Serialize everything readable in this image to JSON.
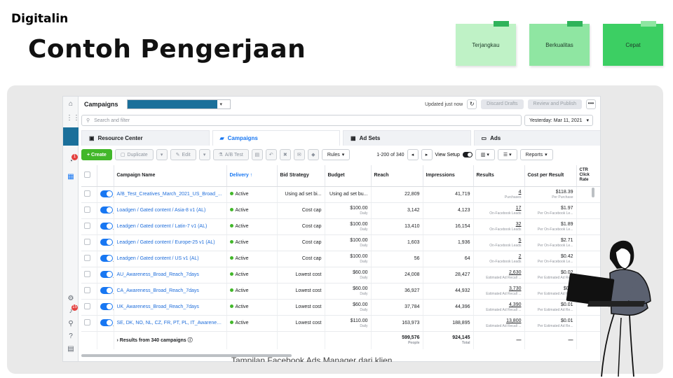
{
  "slide": {
    "brand": "Digitalin",
    "headline": "Contoh Pengerjaan",
    "notes": [
      {
        "label": "Terjangkau",
        "color": "#bff2c6",
        "tape": "#2fb35a"
      },
      {
        "label": "Berkualitas",
        "color": "#8fe6a2",
        "tape": "#2fb35a"
      },
      {
        "label": "Cepat",
        "color": "#3ccf63",
        "tape": "#8fe6a2"
      }
    ],
    "caption": "Tampilan Facebook Ads Manager dari klien"
  },
  "app": {
    "title": "Campaigns",
    "updated": "Updated just now",
    "discard": "Discard Drafts",
    "review": "Review and Publish",
    "more": "•••",
    "search_placeholder": "Search and filter",
    "date": "Yesterday: Mar 11, 2021",
    "tabs": [
      {
        "label": "Resource Center",
        "icon": "calendar-icon"
      },
      {
        "label": "Campaigns",
        "icon": "folder-icon"
      },
      {
        "label": "Ad Sets",
        "icon": "grid-icon"
      },
      {
        "label": "Ads",
        "icon": "ad-icon"
      }
    ],
    "toolbar": {
      "create": "+ Create",
      "duplicate": "Duplicate",
      "edit": "Edit",
      "ab_test": "A/B Test",
      "rules": "Rules",
      "pager": "1-200 of 340",
      "view_setup": "View Setup",
      "reports": "Reports"
    },
    "rail_badge_1": "1",
    "rail_badge_2": "15",
    "columns": [
      "Campaign Name",
      "Delivery ↑",
      "Bid Strategy",
      "Budget",
      "Reach",
      "Impressions",
      "Results",
      "Cost per Result",
      "CTR Click Rate"
    ],
    "rows": [
      {
        "name": "A/B_Test_Creatives_March_2021_US_Broad_...",
        "delivery": "Active",
        "bid": "Using ad set bi...",
        "budget": "Using ad set bu...",
        "budget_sub": "",
        "reach": "22,809",
        "impressions": "41,719",
        "results": "4",
        "results_sub": "Purchases",
        "cpr": "$118.39",
        "cpr_sub": "Per Purchase"
      },
      {
        "name": "Loadgen / Gated content / Asia-8 v1 (AL)",
        "delivery": "Active",
        "bid": "Cost cap",
        "budget": "$100.00",
        "budget_sub": "Daily",
        "reach": "3,142",
        "impressions": "4,123",
        "results": "17",
        "results_sub": "On-Facebook Leads",
        "cpr": "$1.97",
        "cpr_sub": "Per On-Facebook Le..."
      },
      {
        "name": "Leadgen / Gated content / Latin-7 v1 (AL)",
        "delivery": "Active",
        "bid": "Cost cap",
        "budget": "$100.00",
        "budget_sub": "Daily",
        "reach": "13,410",
        "impressions": "16,154",
        "results": "32",
        "results_sub": "On-Facebook Leads",
        "cpr": "$1.89",
        "cpr_sub": "Per On-Facebook Le..."
      },
      {
        "name": "Leadgen / Gated content / Europe-25 v1 (AL)",
        "delivery": "Active",
        "bid": "Cost cap",
        "budget": "$100.00",
        "budget_sub": "Daily",
        "reach": "1,603",
        "impressions": "1,936",
        "results": "5",
        "results_sub": "On-Facebook Leads",
        "cpr": "$2.71",
        "cpr_sub": "Per On-Facebook Le..."
      },
      {
        "name": "Leadgen / Gated content / US v1 (AL)",
        "delivery": "Active",
        "bid": "Cost cap",
        "budget": "$100.00",
        "budget_sub": "Daily",
        "reach": "56",
        "impressions": "64",
        "results": "2",
        "results_sub": "On-Facebook Leads",
        "cpr": "$0.42",
        "cpr_sub": "Per On-Facebook Le..."
      },
      {
        "name": "AU_Awareness_Broad_Reach_7days",
        "delivery": "Active",
        "bid": "Lowest cost",
        "budget": "$60.00",
        "budget_sub": "Daily",
        "reach": "24,008",
        "impressions": "28,427",
        "results": "2,630",
        "results_sub": "Estimated Ad Recall ...",
        "cpr": "$0.02",
        "cpr_sub": "Per Estimated Ad Re..."
      },
      {
        "name": "CA_Awareness_Broad_Reach_7days",
        "delivery": "Active",
        "bid": "Lowest cost",
        "budget": "$60.00",
        "budget_sub": "Daily",
        "reach": "36,927",
        "impressions": "44,932",
        "results": "3,730",
        "results_sub": "Estimated Ad Recall ...",
        "cpr": "$0.0",
        "cpr_sub": "Per Estimated Ad Re..."
      },
      {
        "name": "UK_Awareness_Broad_Reach_7days",
        "delivery": "Active",
        "bid": "Lowest cost",
        "budget": "$60.00",
        "budget_sub": "Daily",
        "reach": "37,784",
        "impressions": "44,396",
        "results": "4,390",
        "results_sub": "Estimated Ad Recall ...",
        "cpr": "$0.01",
        "cpr_sub": "Per Estimated Ad Re..."
      },
      {
        "name": "SE, DK, NO, NL, CZ, FR, PT, PL, IT_Awareness_...",
        "delivery": "Active",
        "bid": "Lowest cost",
        "budget": "$110.00",
        "budget_sub": "Daily",
        "reach": "163,973",
        "impressions": "188,895",
        "results": "13,800",
        "results_sub": "Estimated Ad Recall ...",
        "cpr": "$0.01",
        "cpr_sub": "Per Estimated Ad Re..."
      }
    ],
    "totals": {
      "label": "Results from 340 campaigns",
      "reach": "599,576",
      "reach_sub": "People",
      "impressions": "924,145",
      "impressions_sub": "Total",
      "results": "—",
      "cpr": "—"
    }
  }
}
